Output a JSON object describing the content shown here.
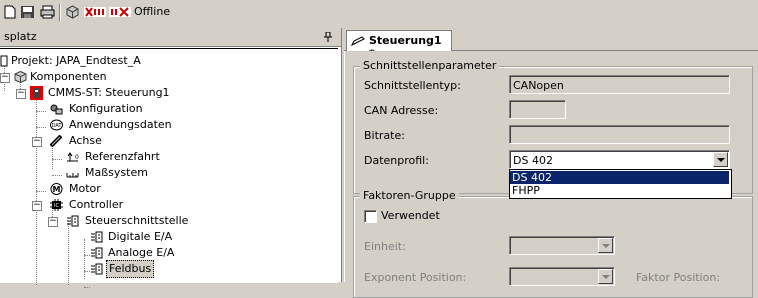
{
  "toolbar": {
    "icons": [
      "page-icon",
      "disk-icon",
      "print-icon",
      "cube-icon",
      "network-online-icon",
      "network-offline-icon"
    ],
    "offline_label": "Offline"
  },
  "left_panel": {
    "title": "splatz",
    "pin": " ᵖ",
    "tree": {
      "project": "Projekt: JAPA_Endtest_A",
      "komponenten": "Komponenten",
      "cmms": "CMMS-ST: Steuerung1",
      "konfiguration": "Konfiguration",
      "anwendungsdaten": "Anwendungsdaten",
      "achse": "Achse",
      "referenzfahrt": "Referenzfahrt",
      "masssystem": "Maßsystem",
      "motor": "Motor",
      "controller": "Controller",
      "steuerschnittstelle": "Steuerschnittstelle",
      "digitale": "Digitale E/A",
      "analoge": "Analoge E/A",
      "feldbus": "Feldbus"
    }
  },
  "right_panel": {
    "tab_label": "Steuerung1 *",
    "schnittstellen": {
      "title": "Schnittstellenparameter",
      "typ_label": "Schnittstellentyp:",
      "typ_value": "CANopen",
      "adresse_label": "CAN Adresse:",
      "bitrate_label": "Bitrate:",
      "profil_label": "Datenprofil:",
      "profil_value": "DS 402",
      "options": [
        "DS 402",
        "FHPP"
      ]
    },
    "faktoren": {
      "title": "Faktoren-Gruppe",
      "verwendet_label": "Verwendet",
      "einheit_label": "Einheit:",
      "exponent_label": "Exponent Position:",
      "faktor_label": "Faktor Position:"
    }
  },
  "colors": {
    "face": "#d4d0c8",
    "selection": "#0a246a",
    "offline_red": "#cc0000"
  }
}
